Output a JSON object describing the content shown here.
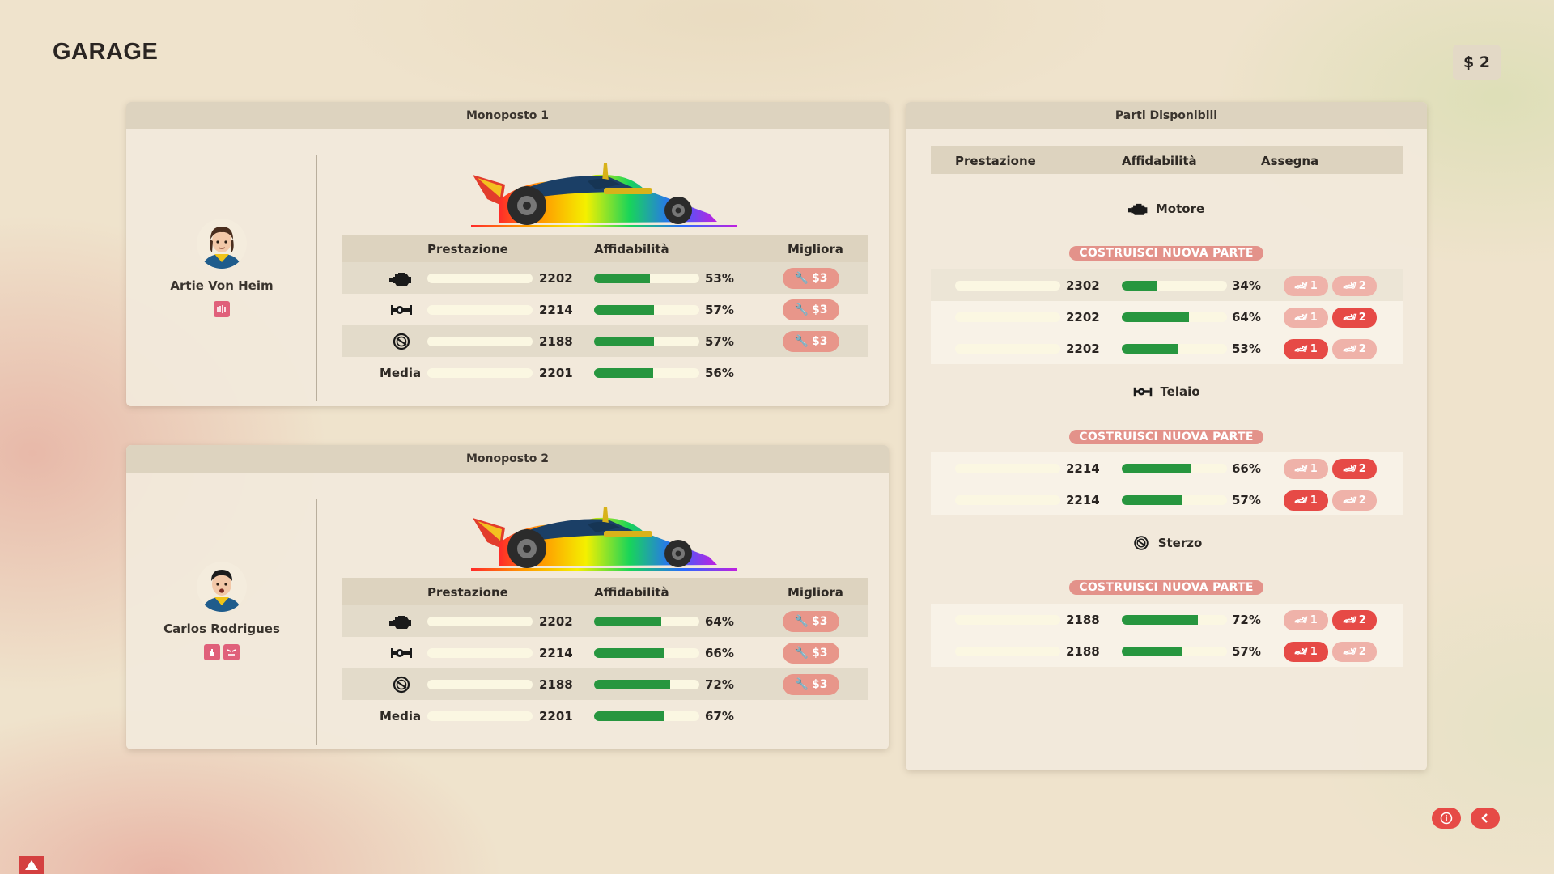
{
  "page": {
    "title": "GARAGE",
    "money": "$ 2"
  },
  "colors": {
    "accent": "#e64a46",
    "bar_fill": "#27963f",
    "upgrade": "#e8968a"
  },
  "columns": {
    "performance": "Prestazione",
    "reliability": "Affidabilità",
    "upgrade": "Migliora",
    "assign": "Assegna"
  },
  "cars": [
    {
      "title": "Monoposto 1",
      "driver": {
        "name": "Artie Von Heim",
        "traits": [
          "sound-wave-icon"
        ]
      },
      "rows": [
        {
          "icon": "engine-icon",
          "performance": "2202",
          "reliability": "53%",
          "reliability_value": 0.53,
          "upgrade": "$3"
        },
        {
          "icon": "chassis-icon",
          "performance": "2214",
          "reliability": "57%",
          "reliability_value": 0.57,
          "upgrade": "$3"
        },
        {
          "icon": "steering-wheel-icon",
          "performance": "2188",
          "reliability": "57%",
          "reliability_value": 0.57,
          "upgrade": "$3"
        }
      ],
      "average": {
        "label": "Media",
        "performance": "2201",
        "reliability": "56%",
        "reliability_value": 0.56
      }
    },
    {
      "title": "Monoposto 2",
      "driver": {
        "name": "Carlos Rodrigues",
        "traits": [
          "hand-icon",
          "angry-face-icon"
        ]
      },
      "rows": [
        {
          "icon": "engine-icon",
          "performance": "2202",
          "reliability": "64%",
          "reliability_value": 0.64,
          "upgrade": "$3"
        },
        {
          "icon": "chassis-icon",
          "performance": "2214",
          "reliability": "66%",
          "reliability_value": 0.66,
          "upgrade": "$3"
        },
        {
          "icon": "steering-wheel-icon",
          "performance": "2188",
          "reliability": "72%",
          "reliability_value": 0.72,
          "upgrade": "$3"
        }
      ],
      "average": {
        "label": "Media",
        "performance": "2201",
        "reliability": "67%",
        "reliability_value": 0.67
      }
    }
  ],
  "parts": {
    "title": "Parti Disponibili",
    "build_label": "COSTRUISCI NUOVA PARTE",
    "assign_labels": [
      "1",
      "2"
    ],
    "categories": [
      {
        "name": "Motore",
        "icon": "engine-icon",
        "items": [
          {
            "performance": "2302",
            "reliability": "34%",
            "reliability_value": 0.34,
            "assigned": 0
          },
          {
            "performance": "2202",
            "reliability": "64%",
            "reliability_value": 0.64,
            "assigned": 2
          },
          {
            "performance": "2202",
            "reliability": "53%",
            "reliability_value": 0.53,
            "assigned": 1
          }
        ]
      },
      {
        "name": "Telaio",
        "icon": "chassis-icon",
        "items": [
          {
            "performance": "2214",
            "reliability": "66%",
            "reliability_value": 0.66,
            "assigned": 2
          },
          {
            "performance": "2214",
            "reliability": "57%",
            "reliability_value": 0.57,
            "assigned": 1
          }
        ]
      },
      {
        "name": "Sterzo",
        "icon": "steering-wheel-icon",
        "items": [
          {
            "performance": "2188",
            "reliability": "72%",
            "reliability_value": 0.72,
            "assigned": 2
          },
          {
            "performance": "2188",
            "reliability": "57%",
            "reliability_value": 0.57,
            "assigned": 1
          }
        ]
      }
    ]
  }
}
